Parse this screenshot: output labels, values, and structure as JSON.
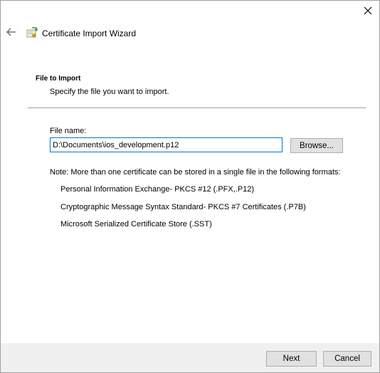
{
  "window": {
    "title": "Certificate Import Wizard"
  },
  "icons": {
    "close": "close-icon",
    "back": "back-arrow-icon",
    "wizard": "certificate-wizard-icon"
  },
  "page": {
    "heading": "File to Import",
    "subheading": "Specify the file you want to import.",
    "file_name_label": "File name:",
    "file_name_value": "D:\\Documents\\ios_development.p12",
    "browse_label": "Browse...",
    "note": "Note:  More than one certificate can be stored in a single file in the following formats:",
    "formats": [
      "Personal Information Exchange- PKCS #12 (.PFX,.P12)",
      "Cryptographic Message Syntax Standard- PKCS #7 Certificates (.P7B)",
      "Microsoft Serialized Certificate Store (.SST)"
    ]
  },
  "footer": {
    "next_label": "Next",
    "cancel_label": "Cancel"
  },
  "colors": {
    "input_border_focus": "#0078d7",
    "footer_bg": "#f0f0f0",
    "button_bg": "#e1e1e1",
    "button_border": "#adadad"
  }
}
